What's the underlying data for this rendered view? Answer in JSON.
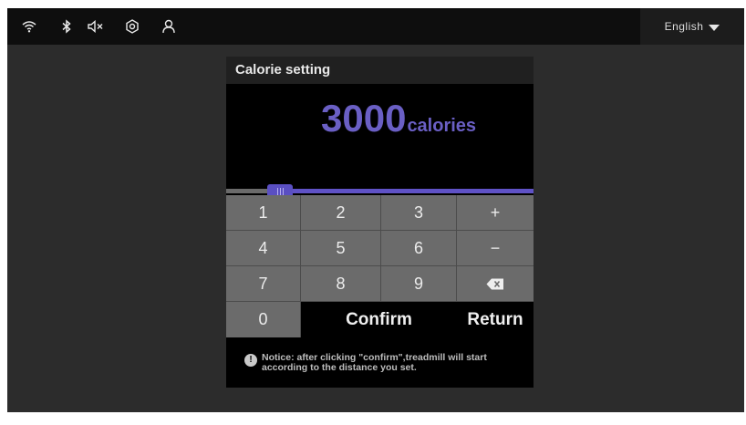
{
  "status_icons": [
    "wifi-icon",
    "bluetooth-icon",
    "mute-icon",
    "settings-icon",
    "user-icon"
  ],
  "language": {
    "selected": "English"
  },
  "dialog": {
    "title": "Calorie setting",
    "value": "3000",
    "unit": "calories",
    "slider_fraction": 0.16,
    "keys": {
      "k1": "1",
      "k2": "2",
      "k3": "3",
      "plus": "+",
      "k4": "4",
      "k5": "5",
      "k6": "6",
      "minus": "−",
      "k7": "7",
      "k8": "8",
      "k9": "9",
      "k0": "0",
      "confirm": "Confirm",
      "return": "Return"
    },
    "notice_line1": "Notice: after clicking \"confirm\",treadmill will start",
    "notice_line2": "according to the distance you set."
  },
  "colors": {
    "accent": "#5f52c6",
    "value_text": "#6a5fc4",
    "key_bg": "#6b6b6b"
  }
}
